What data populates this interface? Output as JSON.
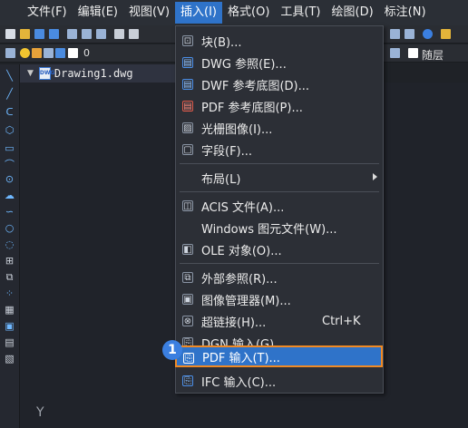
{
  "menubar": {
    "items": [
      "文件(F)",
      "编辑(E)",
      "视图(V)",
      "插入(I)",
      "格式(O)",
      "工具(T)",
      "绘图(D)",
      "标注(N)"
    ]
  },
  "toolbar": {
    "layer_value": "0",
    "right_label": "随层"
  },
  "document_tab": {
    "filename": "Drawing1.dwg",
    "file_icon_label": "DWG"
  },
  "canvas": {
    "axis_label": "Y"
  },
  "insert_menu": {
    "items": [
      {
        "label": "块(B)...",
        "icon": "block-icon"
      },
      {
        "label": "DWG 参照(E)...",
        "icon": "dwg-reference-icon"
      },
      {
        "label": "DWF 参考底图(D)...",
        "icon": "dwf-underlay-icon"
      },
      {
        "label": "PDF 参考底图(P)...",
        "icon": "pdf-underlay-icon"
      },
      {
        "label": "光栅图像(I)...",
        "icon": "raster-image-icon"
      },
      {
        "label": "字段(F)...",
        "icon": "field-icon"
      },
      {
        "label": "布局(L)",
        "icon": "",
        "submenu": true
      },
      {
        "label": "ACIS 文件(A)...",
        "icon": "acis-icon"
      },
      {
        "label": "Windows 图元文件(W)...",
        "icon": ""
      },
      {
        "label": "OLE 对象(O)...",
        "icon": "ole-icon"
      },
      {
        "label": "外部参照(R)...",
        "icon": "xref-icon"
      },
      {
        "label": "图像管理器(M)...",
        "icon": "image-manager-icon"
      },
      {
        "label": "超链接(H)...",
        "icon": "hyperlink-icon",
        "shortcut": "Ctrl+K"
      },
      {
        "label": "DGN 输入(G)...",
        "icon": "dgn-import-icon"
      },
      {
        "label": "PDF 输入(T)...",
        "icon": "pdf-import-icon",
        "highlighted": true
      },
      {
        "label": "IFC 输入(C)...",
        "icon": "ifc-import-icon"
      }
    ]
  },
  "callout": {
    "number": "1"
  },
  "colors": {
    "menu_highlight": "#2f73c9",
    "callout_border": "#f08a24",
    "callout_badge": "#3b7fe0"
  }
}
